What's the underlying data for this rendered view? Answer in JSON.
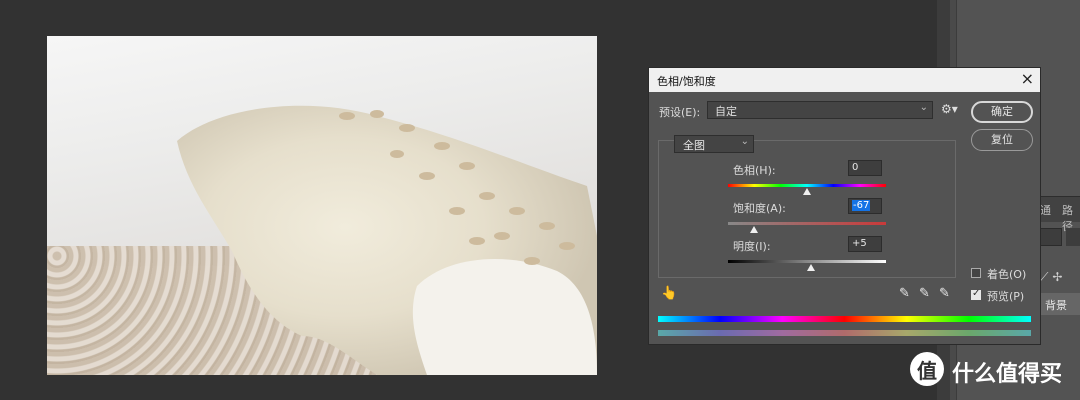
{
  "dialog": {
    "title": "色相/饱和度",
    "close": "×",
    "preset_label": "预设(E):",
    "preset_value": "自定",
    "ok_label": "确定",
    "reset_label": "复位",
    "range_value": "全图",
    "hue_label": "色相(H):",
    "hue_value": "0",
    "saturation_label": "饱和度(A):",
    "saturation_value": "-67",
    "lightness_label": "明度(I):",
    "lightness_value": "+5",
    "colorize_label": "着色(O)",
    "colorize_checked": false,
    "preview_label": "预览(P)",
    "preview_checked": true,
    "hue_slider_fraction": 0.5,
    "saturation_slider_fraction": 0.165,
    "lightness_slider_fraction": 0.525
  },
  "icons": {
    "gear": "⚙",
    "hand_tool": "👆",
    "eyedropper": "✎",
    "eyedropper_plus": "✎",
    "eyedropper_minus": "✎",
    "chevron": "⌄"
  },
  "right_panel": {
    "tab1": "通",
    "tab2": "路径",
    "layer_name": "背景"
  },
  "watermark": {
    "logo_char": "值",
    "text": "什么值得买"
  },
  "colors": {
    "panel_bg": "#535353",
    "title_bg": "#f0f0f0",
    "selection": "#1473e6"
  }
}
